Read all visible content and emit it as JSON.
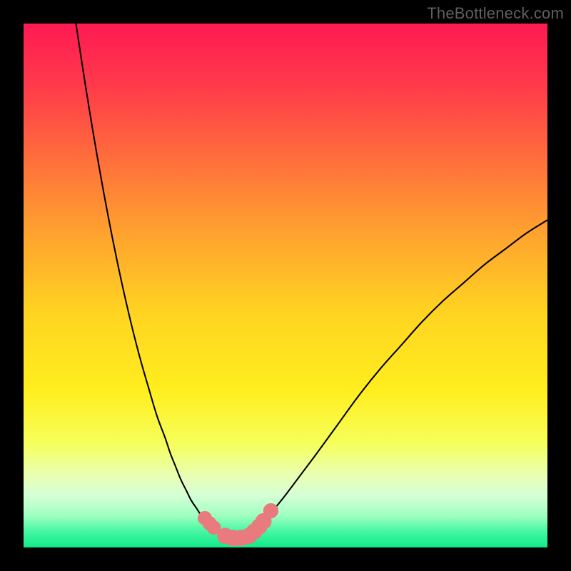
{
  "watermark": "TheBottleneck.com",
  "palette": {
    "black": "#000000",
    "curve_stroke": "#000000",
    "marker_fill": "#e97a7d",
    "marker_stroke": "#e97a7d"
  },
  "chart_data": {
    "type": "line",
    "title": "",
    "xlabel": "",
    "ylabel": "",
    "xlim": [
      0,
      100
    ],
    "ylim": [
      0,
      100
    ],
    "gradient_stops": [
      {
        "offset": 0.0,
        "color": "#ff1a53"
      },
      {
        "offset": 0.12,
        "color": "#ff3b4a"
      },
      {
        "offset": 0.25,
        "color": "#ff6b3c"
      },
      {
        "offset": 0.4,
        "color": "#ffa22f"
      },
      {
        "offset": 0.55,
        "color": "#ffd321"
      },
      {
        "offset": 0.7,
        "color": "#ffee1e"
      },
      {
        "offset": 0.8,
        "color": "#f6ff5a"
      },
      {
        "offset": 0.86,
        "color": "#eaffb0"
      },
      {
        "offset": 0.9,
        "color": "#d6ffd6"
      },
      {
        "offset": 0.94,
        "color": "#9effc1"
      },
      {
        "offset": 0.97,
        "color": "#43f6a1"
      },
      {
        "offset": 1.0,
        "color": "#13e98a"
      }
    ],
    "series": [
      {
        "name": "left-branch",
        "x": [
          10.0,
          12.0,
          14.0,
          16.0,
          18.0,
          20.0,
          22.0,
          24.0,
          25.5,
          27.0,
          28.0,
          29.0,
          30.0,
          31.0,
          32.0,
          33.0,
          34.0,
          35.0,
          36.0,
          37.0
        ],
        "y": [
          100.0,
          87.0,
          75.0,
          64.0,
          54.0,
          45.0,
          37.0,
          30.0,
          25.0,
          21.0,
          18.0,
          15.5,
          13.0,
          11.0,
          9.0,
          7.5,
          6.0,
          5.0,
          4.0,
          3.2
        ]
      },
      {
        "name": "valley-floor",
        "x": [
          37.0,
          38.0,
          39.0,
          40.0,
          41.0,
          42.0,
          43.0,
          44.0
        ],
        "y": [
          3.2,
          2.4,
          1.9,
          1.6,
          1.6,
          1.9,
          2.4,
          3.2
        ]
      },
      {
        "name": "right-branch",
        "x": [
          44.0,
          46.0,
          48.0,
          50.0,
          53.0,
          56.0,
          60.0,
          64.0,
          68.0,
          72.0,
          76.0,
          80.0,
          84.0,
          88.0,
          92.0,
          96.0,
          100.0
        ],
        "y": [
          3.2,
          5.0,
          7.5,
          10.0,
          14.0,
          18.0,
          23.5,
          29.0,
          34.0,
          38.5,
          43.0,
          47.0,
          50.5,
          54.0,
          57.0,
          60.0,
          62.5
        ]
      }
    ],
    "markers": [
      {
        "x": 34.6,
        "y": 5.6,
        "r": 1.3
      },
      {
        "x": 35.5,
        "y": 4.6,
        "r": 1.3
      },
      {
        "x": 36.3,
        "y": 3.8,
        "r": 1.3
      },
      {
        "x": 38.5,
        "y": 2.2,
        "r": 1.5
      },
      {
        "x": 40.0,
        "y": 1.8,
        "r": 1.5
      },
      {
        "x": 41.5,
        "y": 1.8,
        "r": 1.5
      },
      {
        "x": 43.0,
        "y": 2.2,
        "r": 1.5
      },
      {
        "x": 44.0,
        "y": 3.0,
        "r": 1.5
      },
      {
        "x": 45.0,
        "y": 4.0,
        "r": 1.5
      },
      {
        "x": 45.8,
        "y": 5.0,
        "r": 1.5
      },
      {
        "x": 47.2,
        "y": 7.0,
        "r": 1.4
      }
    ]
  }
}
